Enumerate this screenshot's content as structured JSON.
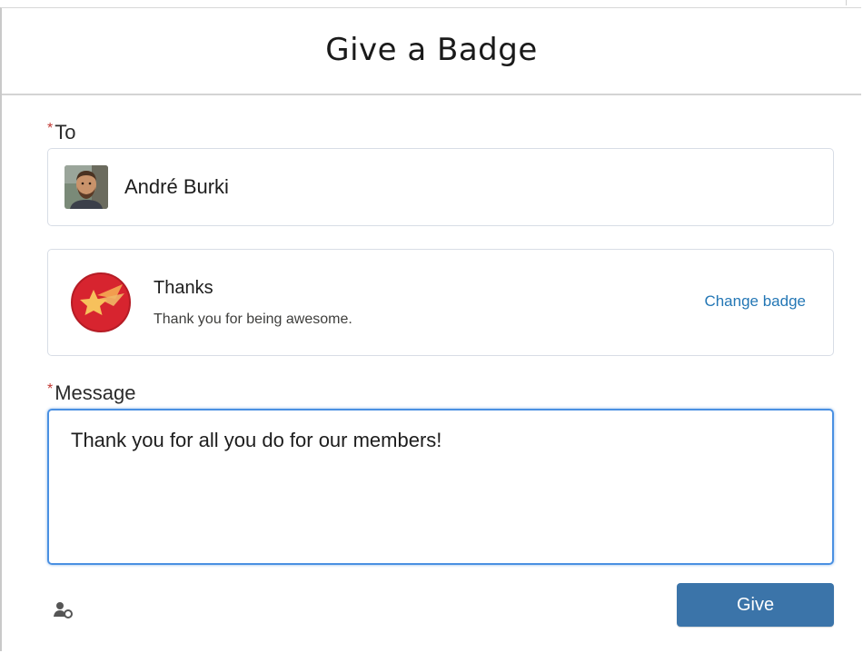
{
  "modal": {
    "title": "Give a Badge"
  },
  "to_field": {
    "label": "To",
    "required_mark": "*",
    "recipient_name": "André Burki",
    "avatar_icon": "user-photo"
  },
  "badge": {
    "name": "Thanks",
    "description": "Thank you for being awesome.",
    "change_link": "Change badge",
    "icon": "shooting-star-icon",
    "colors": {
      "circle": "#d7242f",
      "star": "#f7c15c"
    }
  },
  "message_field": {
    "label": "Message",
    "required_mark": "*",
    "value": "Thank you for all you do for our members!"
  },
  "footer": {
    "give_label": "Give",
    "left_icon": "people-icon"
  },
  "colors": {
    "accent": "#3b74a9",
    "link": "#2477b5",
    "required": "#c23934",
    "focus_border": "#4a90e2"
  }
}
